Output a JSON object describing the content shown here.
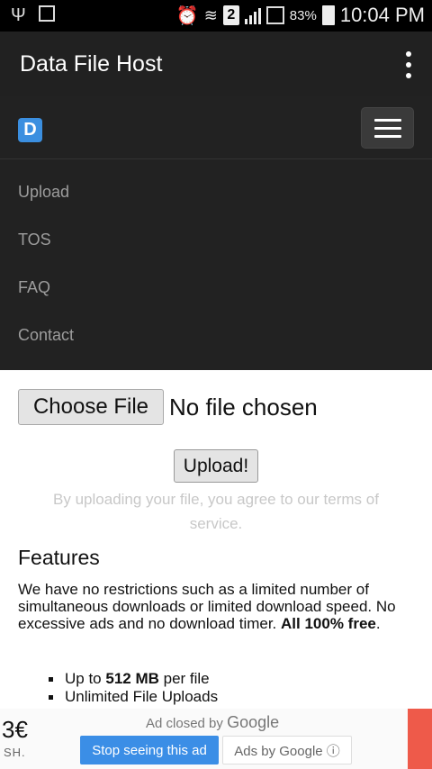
{
  "status_bar": {
    "battery_percent": "83%",
    "time": "10:04 PM",
    "sim_badge": "2",
    "icons": [
      "usb-icon",
      "image-icon",
      "alarm-icon",
      "wifi-icon",
      "signal-icon",
      "battery-charging-icon"
    ]
  },
  "app_bar": {
    "title": "Data File Host",
    "menu_icon": "more-vert-icon"
  },
  "site_nav": {
    "logo_letter": "D",
    "items": [
      "Upload",
      "TOS",
      "FAQ",
      "Contact"
    ]
  },
  "upload": {
    "choose_label": "Choose File",
    "file_status": "No file chosen",
    "upload_label": "Upload!",
    "terms_text": "By uploading your file, you agree to our terms of service."
  },
  "features": {
    "title": "Features",
    "text_main": "We have no restrictions such as a limited number of simultaneous downloads or limited download speed. No excessive ads and no download timer. ",
    "text_bold": "All 100% free",
    "text_end": ".",
    "list": [
      {
        "pre": "Up to ",
        "bold": "512 MB",
        "post": " per file"
      },
      {
        "pre": "Unlimited File Uploads",
        "bold": "",
        "post": ""
      }
    ]
  },
  "ad": {
    "partial_number": "3€",
    "partial_label": "SH.",
    "closed_text": "Ad closed by",
    "closed_brand": "Google",
    "stop_label": "Stop seeing this ad",
    "adsby_label": "Ads by Google ⓘ",
    "accent_color": "#ee5a4a"
  }
}
